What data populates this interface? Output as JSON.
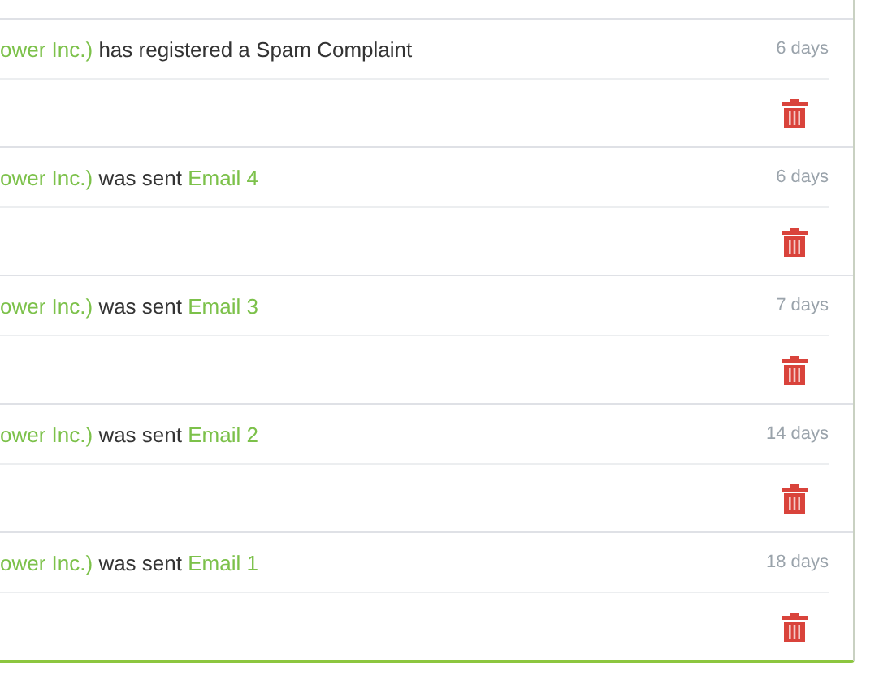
{
  "activities": [
    {
      "contact": "ower Inc.)",
      "action": "has registered a Spam Complaint",
      "time": "6 days"
    },
    {
      "contact": "ower Inc.)",
      "action": "was sent",
      "email": "Email 4",
      "time": "6 days"
    },
    {
      "contact": "ower Inc.)",
      "action": "was sent",
      "email": "Email 3",
      "time": "7 days"
    },
    {
      "contact": "ower Inc.)",
      "action": "was sent",
      "email": "Email 2",
      "time": "14 days"
    },
    {
      "contact": "ower Inc.)",
      "action": "was sent",
      "email": "Email 1",
      "time": "18 days"
    }
  ]
}
